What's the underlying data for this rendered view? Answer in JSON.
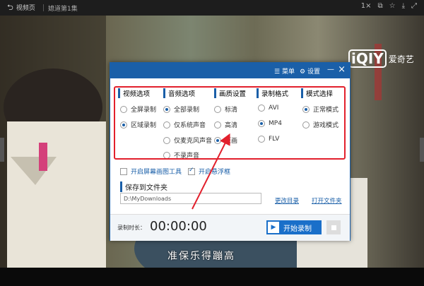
{
  "topbar": {
    "back_label": "视频页",
    "video_title": "媳道第1集",
    "icons": [
      "speed-icon",
      "restore-icon",
      "favorite-icon",
      "download-icon",
      "maximize-icon"
    ],
    "speed_label": "1×"
  },
  "video": {
    "logo_mark": "iQIY",
    "logo_text": "爱奇艺",
    "subtitle": "准保乐得蹦高"
  },
  "dialog": {
    "menu_label": "菜单",
    "settings_label": "设置",
    "sections": {
      "video_options": {
        "title": "视频选项",
        "options": [
          {
            "label": "全屏录制",
            "selected": false
          },
          {
            "label": "区域录制",
            "selected": true
          }
        ]
      },
      "audio_options": {
        "title": "音频选项",
        "options": [
          {
            "label": "全部录制",
            "selected": true
          },
          {
            "label": "仅系统声音",
            "selected": false
          },
          {
            "label": "仅麦克风声音",
            "selected": false
          },
          {
            "label": "不录声音",
            "selected": false
          }
        ]
      },
      "quality": {
        "title": "画质设置",
        "options": [
          {
            "label": "标清",
            "selected": false
          },
          {
            "label": "高清",
            "selected": false
          },
          {
            "label": "原画",
            "selected": true
          }
        ]
      },
      "format": {
        "title": "录制格式",
        "options": [
          {
            "label": "AVI",
            "selected": false
          },
          {
            "label": "MP4",
            "selected": true
          },
          {
            "label": "FLV",
            "selected": false
          }
        ]
      },
      "mode": {
        "title": "模式选择",
        "options": [
          {
            "label": "正常模式",
            "selected": true
          },
          {
            "label": "游戏模式",
            "selected": false
          }
        ]
      }
    },
    "checkboxes": [
      {
        "label": "开启屏幕画图工具",
        "checked": false
      },
      {
        "label": "开启悬浮框",
        "checked": true
      }
    ],
    "save_title": "保存到文件夹",
    "save_path": "D:\\MyDownloads",
    "change_dir": "更改目录",
    "open_folder": "打开文件夹",
    "time_label": "录制时长：",
    "time_value": "00:00:00",
    "start_label": "开始录制"
  },
  "colors": {
    "accent": "#1a5fa8",
    "highlight_box": "#e2202c"
  }
}
